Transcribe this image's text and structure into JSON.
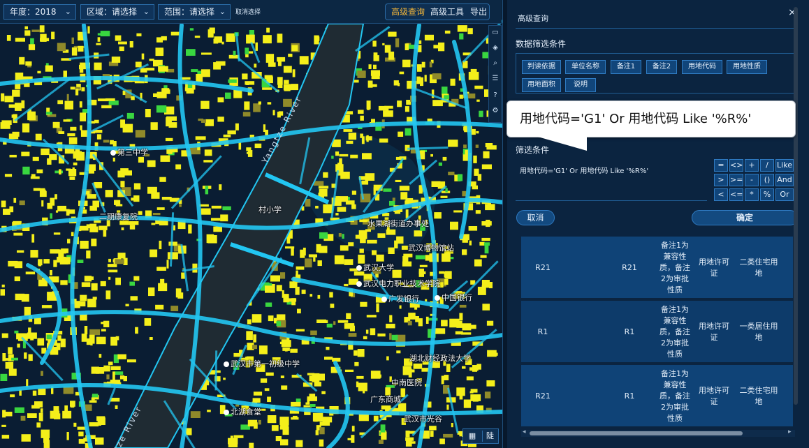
{
  "toolbar": {
    "year_select": "年度：2018",
    "region_select": "区域：请选择",
    "range_select": "范围：请选择",
    "clear_text": "取消选择",
    "advanced_query": "高级查询",
    "advanced_tools": "高级工具",
    "export": "导出"
  },
  "map_labels": {
    "school_1": "第三中学",
    "kangfu": "二期康复院",
    "village": "村小学",
    "water": "水果湖街道办事处",
    "museum": "武汉博物馆站",
    "wuhan_univ": "武汉大学",
    "electric": "武汉电力职业技术学院",
    "bank1": "广发银行",
    "bank2": "中国银行",
    "market": "广东商城",
    "hospital": "中南医院",
    "finance": "湖北财经政法大学",
    "north": "北湖食堂",
    "road": "武汉市第一初级中学",
    "tech": "武汉市光谷",
    "river_top": "Yangtze River",
    "river_bottom": "tze River",
    "corner_a": "▦",
    "corner_b": "陡"
  },
  "panel": {
    "title": "高级查询",
    "close": "×",
    "filter_section": "数据筛选条件",
    "field_buttons": [
      "判读依据",
      "单位名称",
      "备注1",
      "备注2",
      "用地代码",
      "用地性质",
      "用地面积",
      "说明"
    ],
    "tooltip": "用地代码='G1' Or 用地代码 Like '%R%'",
    "condition_label": "筛选条件",
    "condition_text": "用地代码='G1' Or 用地代码 Like '%R%'",
    "operators_row1": [
      "=",
      "<>",
      "+",
      "/",
      "Like"
    ],
    "operators_row2": [
      ">",
      ">=",
      "-",
      "()",
      "And"
    ],
    "operators_row3": [
      "<",
      "<=",
      "*",
      "%",
      "Or"
    ],
    "cancel": "取消",
    "confirm": "确定"
  },
  "results": [
    {
      "c1": "R21",
      "c2": "R21",
      "c3": "备注1为兼容性质，备注2为审批性质",
      "c4": "用地许可证",
      "c5": "二类住宅用地"
    },
    {
      "c1": "R1",
      "c2": "R1",
      "c3": "备注1为兼容性质，备注2为审批性质",
      "c4": "用地许可证",
      "c5": "一类居住用地"
    },
    {
      "c1": "R21",
      "c2": "R1",
      "c3": "备注1为兼容性质，备注2为审批性质",
      "c4": "用地许可证",
      "c5": "二类住宅用地"
    }
  ],
  "colors": {
    "accent": "#f2b63a",
    "road": "#22c6f2",
    "parcel": "#f4ef1a",
    "green": "#39d640",
    "river": "#1f2b33"
  }
}
